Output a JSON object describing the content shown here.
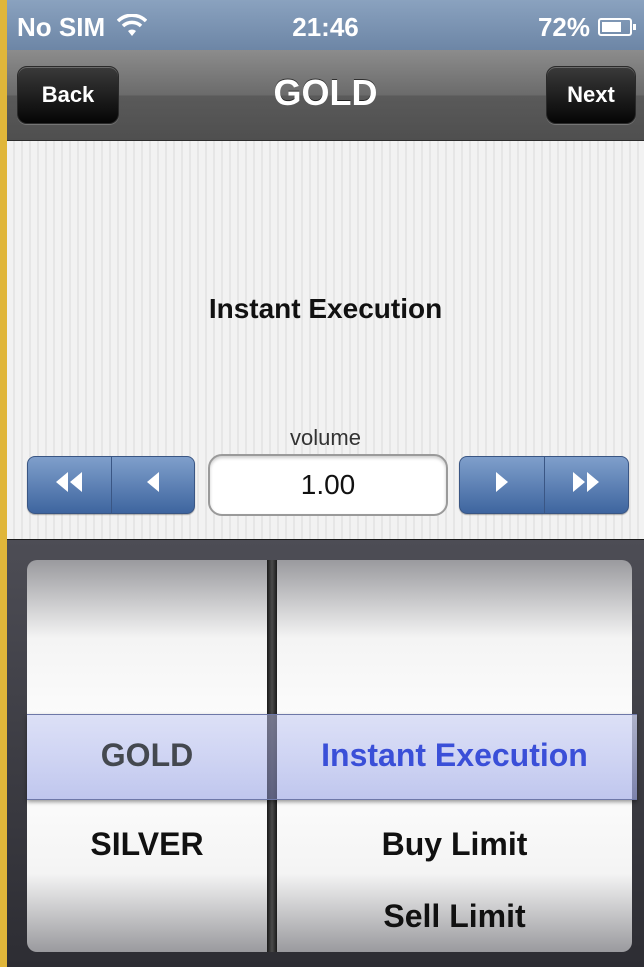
{
  "status_bar": {
    "carrier": "No SIM",
    "wifi_icon": "wifi-icon",
    "time": "21:46",
    "battery_text": "72%",
    "battery_level": 0.72,
    "battery_icon": "battery-icon"
  },
  "nav_bar": {
    "back_label": "Back",
    "title": "GOLD",
    "next_label": "Next"
  },
  "order": {
    "type_label": "Instant Execution",
    "volume_label": "volume",
    "volume_value": "1.00",
    "step_icons": [
      "double-left-arrow-icon",
      "left-arrow-icon",
      "right-arrow-icon",
      "double-right-arrow-icon"
    ]
  },
  "picker": {
    "symbols": {
      "selected": "GOLD",
      "below": [
        "SILVER"
      ]
    },
    "order_types": {
      "selected": "Instant Execution",
      "below": [
        "Buy Limit",
        "Sell Limit"
      ]
    },
    "colors": {
      "selected_order_type": "#3a4fd8",
      "selected_symbol": "#44484f"
    }
  },
  "colors": {
    "status_bar": "#7a92b2",
    "nav_bar": "#6b6b6b",
    "stepper": "#5a7db5",
    "page_background": "#e0b63a"
  }
}
